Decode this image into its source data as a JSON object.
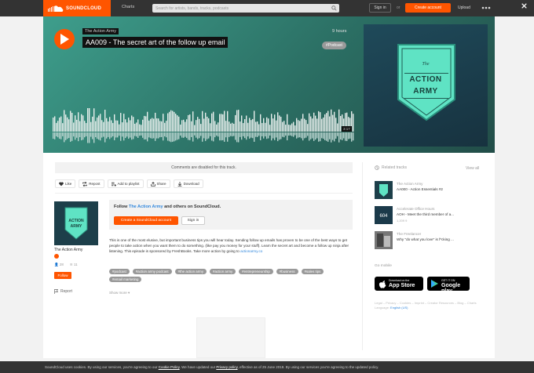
{
  "header": {
    "brand": "SOUNDCLOUD",
    "nav_charts": "Charts",
    "search_placeholder": "Search for artists, bands, tracks, podcasts",
    "signin": "Sign in",
    "or": "or",
    "create_account": "Create account",
    "upload": "Upload"
  },
  "hero": {
    "artist": "The Action Army",
    "title": "AA009 - The secret art of the follow up email",
    "posted": "9 hours",
    "genre": "#Podcast",
    "duration": "3:17",
    "artwork_text_the": "The",
    "artwork_text_main_1": "ACTION",
    "artwork_text_main_2": "ARMY"
  },
  "track": {
    "comments_disabled": "Comments are disabled for this track.",
    "actions": [
      "Like",
      "Repost",
      "Add to playlist",
      "Share",
      "Download"
    ],
    "artist_name": "The Action Army",
    "artist_followers": "28",
    "artist_tracks": "11",
    "follow": "Follow",
    "report": "Report",
    "follow_prompt_pre": "Follow ",
    "follow_prompt_link": "The Action Army",
    "follow_prompt_post": " and others on SoundCloud.",
    "follow_create": "Create a SoundCloud account",
    "follow_signin": "Sign in",
    "description": "This is one of the most elusive, but important business tips you will hear today. Sending follow up emails has proven to be one of the best ways to get people to take action when you want them to do something. (like pay you money for your stuff). Learn the secret art and become a follow up ninja after listening. This episode is sponsored by FreshBooks. Take more action by going to ",
    "description_link": "actionarmy.co",
    "tags": [
      "#podcast",
      "#action army podcast",
      "#the action army",
      "#action army",
      "#entrepreneurship",
      "#business",
      "#sales tips",
      "#email marketing"
    ],
    "show_more": "Show more ▾"
  },
  "sidebar": {
    "related_heading": "Related tracks",
    "view_all": "View all",
    "related": [
      {
        "artist": "The Action Army",
        "title": "AA000 - Action Essentials #2",
        "stats": ""
      },
      {
        "artist": "Accelerate Office Hours",
        "title": "AOH - Meet the third member of a...",
        "stats": "1,209   9"
      },
      {
        "artist": "The Freelancer",
        "title": "Why \"do what you love\" is f*cking ...",
        "stats": ""
      }
    ],
    "go_mobile": "Go mobile",
    "app_store_small": "Download on the",
    "app_store_big": "App Store",
    "google_play_small": "GET IT ON",
    "google_play_big": "Google play",
    "footer_links": "Legal – Privacy – Cookies – Imprint – Creator Resources – Blog – Charts",
    "language_label": "Language:",
    "language_value": "English (US)"
  },
  "cookie": {
    "text_pre": "SoundCloud uses cookies. By using our services, you're agreeing to our ",
    "link_cookie": "Cookie Policy",
    "text_mid": ". We have updated our ",
    "link_privacy": "Privacy policy",
    "text_post": ", effective as of 25 June 2018. By using our services you're agreeing to the updated policy."
  },
  "colors": {
    "accent": "#ff5500",
    "header_bg": "#333333",
    "hero_start": "#3e9e8c",
    "hero_end": "#224d48",
    "link": "#3388dd"
  }
}
